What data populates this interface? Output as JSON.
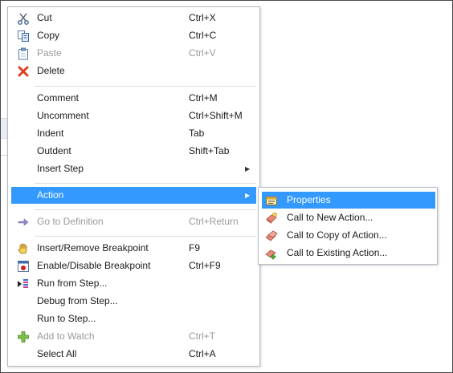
{
  "context_menu": {
    "items": [
      {
        "label": "Cut",
        "shortcut": "Ctrl+X",
        "icon": "scissors-icon"
      },
      {
        "label": "Copy",
        "shortcut": "Ctrl+C",
        "icon": "copy-icon"
      },
      {
        "label": "Paste",
        "shortcut": "Ctrl+V",
        "icon": "clipboard-icon"
      },
      {
        "label": "Delete",
        "shortcut": "",
        "icon": "red-x-icon"
      },
      {
        "label": "Comment",
        "shortcut": "Ctrl+M"
      },
      {
        "label": "Uncomment",
        "shortcut": "Ctrl+Shift+M"
      },
      {
        "label": "Indent",
        "shortcut": "Tab"
      },
      {
        "label": "Outdent",
        "shortcut": "Shift+Tab"
      },
      {
        "label": "Insert Step",
        "has_submenu": true
      },
      {
        "label": "Action",
        "has_submenu": true,
        "highlighted": true
      },
      {
        "label": "Go to Definition",
        "shortcut": "Ctrl+Return",
        "icon": "arrow-right-icon"
      },
      {
        "label": "Insert/Remove Breakpoint",
        "shortcut": "F9",
        "icon": "hand-icon"
      },
      {
        "label": "Enable/Disable Breakpoint",
        "shortcut": "Ctrl+F9",
        "icon": "breakpoint-toggle-icon"
      },
      {
        "label": "Run from Step...",
        "icon": "run-from-step-icon"
      },
      {
        "label": "Debug from Step..."
      },
      {
        "label": "Run to Step..."
      },
      {
        "label": "Add to Watch",
        "shortcut": "Ctrl+T",
        "icon": "green-plus-icon"
      },
      {
        "label": "Select All",
        "shortcut": "Ctrl+A"
      }
    ],
    "disabled": [
      "Paste",
      "Go to Definition",
      "Add to Watch"
    ]
  },
  "action_submenu": {
    "items": [
      {
        "label": "Properties",
        "icon": "properties-icon",
        "highlighted": true
      },
      {
        "label": "Call to New Action...",
        "icon": "new-action-icon"
      },
      {
        "label": "Call to Copy of Action...",
        "icon": "copy-action-icon"
      },
      {
        "label": "Call to Existing Action...",
        "icon": "existing-action-icon"
      }
    ]
  },
  "colors": {
    "highlight": "#3399ff",
    "disabled_text": "#9a9a9a",
    "delete_icon": "#e04020",
    "watch_plus": "#5aa832"
  }
}
